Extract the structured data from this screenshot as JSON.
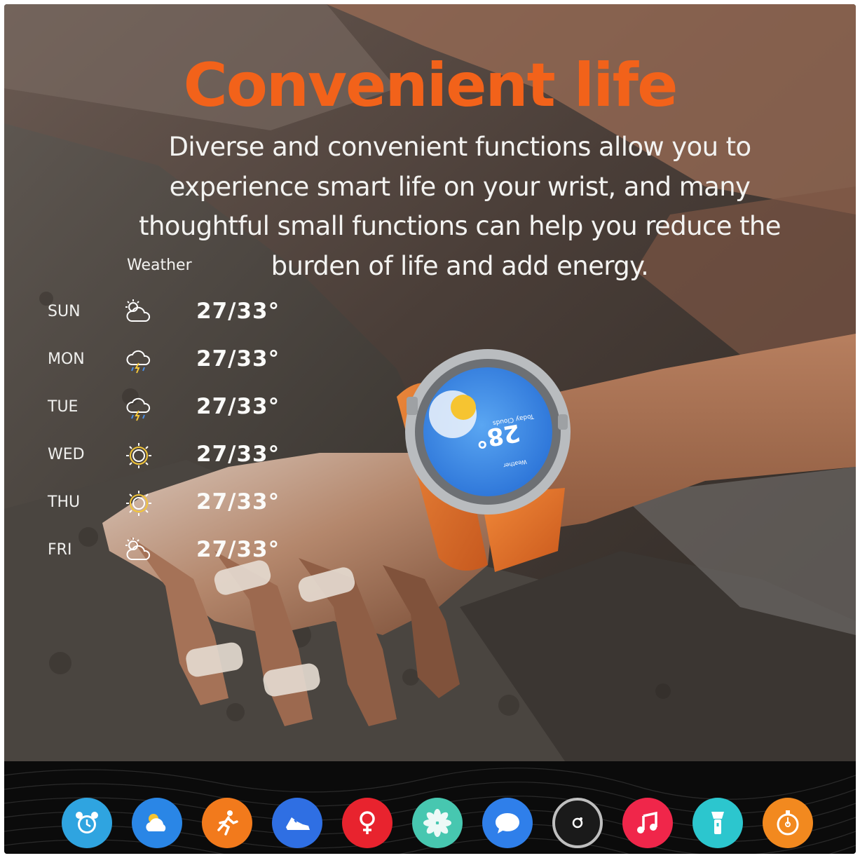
{
  "headline": "Convenient life",
  "description_lines": [
    "Diverse and convenient functions allow you to",
    "experience smart life on your wrist, and many",
    "thoughtful small functions can help you reduce the",
    "burden of life and add energy."
  ],
  "weather": {
    "label": "Weather",
    "days": [
      {
        "day": "SUN",
        "icon": "sun-cloud-icon",
        "temp": "27/33°"
      },
      {
        "day": "MON",
        "icon": "storm-cloud-icon",
        "temp": "27/33°"
      },
      {
        "day": "TUE",
        "icon": "storm-cloud-icon",
        "temp": "27/33°"
      },
      {
        "day": "WED",
        "icon": "sun-icon",
        "temp": "27/33°"
      },
      {
        "day": "THU",
        "icon": "sun-icon",
        "temp": "27/33°"
      },
      {
        "day": "FRI",
        "icon": "sun-cloud-icon",
        "temp": "27/33°"
      }
    ]
  },
  "watch": {
    "temperature": "28°",
    "condition": "Today Clouds",
    "app_label": "Weather"
  },
  "apps": [
    {
      "name": "alarm-clock-icon",
      "color": "#2fa4e0"
    },
    {
      "name": "weather-icon",
      "color": "#2a86e6"
    },
    {
      "name": "running-icon",
      "color": "#f27a1c"
    },
    {
      "name": "sneaker-icon",
      "color": "#2f6fe3"
    },
    {
      "name": "female-health-icon",
      "color": "#e8232e"
    },
    {
      "name": "breathing-flower-icon",
      "color": "#47c7b0"
    },
    {
      "name": "message-icon",
      "color": "#2f7fea"
    },
    {
      "name": "camera-shutter-icon",
      "color": "#1a1a1a"
    },
    {
      "name": "music-icon",
      "color": "#f0264a"
    },
    {
      "name": "flashlight-icon",
      "color": "#2cc6ce"
    },
    {
      "name": "stopwatch-icon",
      "color": "#f2891f"
    }
  ],
  "colors": {
    "headline": "#f2621a",
    "text": "#f3f3f1",
    "watch_screen": "#3b8ee8",
    "strap": "#f07a2a"
  }
}
